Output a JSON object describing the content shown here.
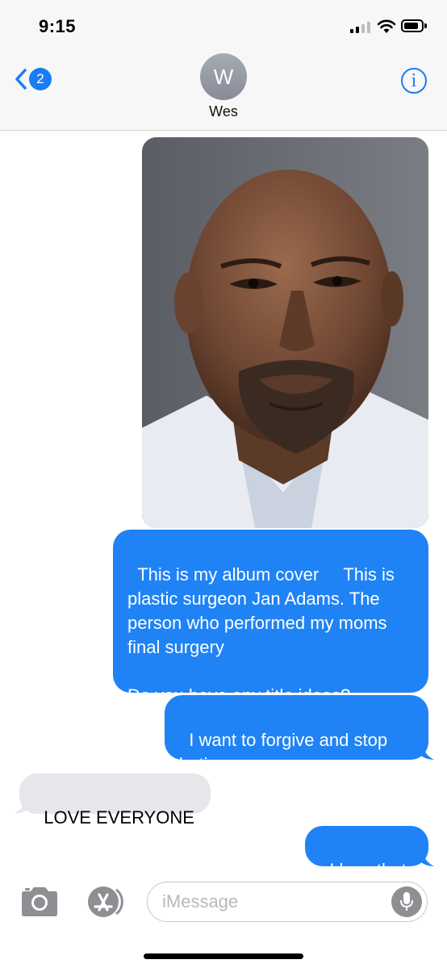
{
  "status_bar": {
    "time": "9:15"
  },
  "header": {
    "back_badge": "2",
    "avatar_initial": "W",
    "contact_name": "Wes",
    "info_glyph": "i"
  },
  "messages": [
    {
      "type": "image",
      "direction": "sent",
      "alt": "photo"
    },
    {
      "direction": "sent",
      "text": "This is my album cover     This is plastic surgeon Jan Adams. The person who performed my moms final surgery\n\nDo you have any title ideas?"
    },
    {
      "direction": "sent",
      "text": "I want to forgive and stop hating"
    },
    {
      "direction": "received",
      "text": "LOVE EVERYONE"
    },
    {
      "direction": "sent",
      "text": "I love that"
    }
  ],
  "composer": {
    "placeholder": "iMessage",
    "icons": [
      "camera-icon",
      "app-store-icon",
      "microphone-icon"
    ]
  },
  "colors": {
    "accent": "#1a7cf5",
    "sent_bubble": "#1f83f5",
    "received_bubble": "#e6e6eb"
  }
}
